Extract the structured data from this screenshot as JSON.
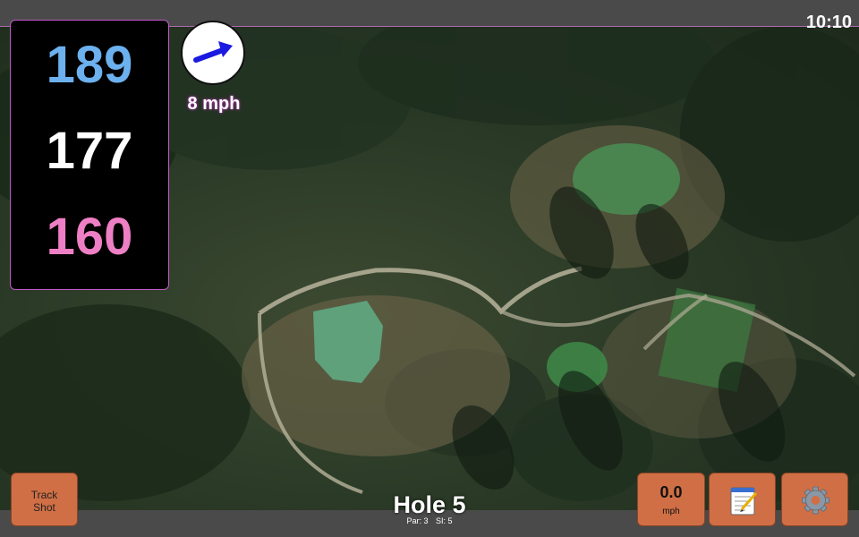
{
  "status_bar": {
    "time": "10:10"
  },
  "distances": {
    "back": "189",
    "middle": "177",
    "front": "160"
  },
  "wind": {
    "speed_label": "8 mph",
    "direction_icon": "arrow-icon",
    "arrow_color": "#1a1ae0"
  },
  "hole": {
    "title": "Hole 5",
    "par_label": "Par: 3",
    "si_label": "SI: 5"
  },
  "buttons": {
    "track_shot_label_line1": "Track",
    "track_shot_label_line2": "Shot",
    "speed_value": "0.0",
    "speed_unit": "mph",
    "notes_icon": "notepad-icon",
    "settings_icon": "gear-icon"
  },
  "colors": {
    "back_distance": "#6cb0ee",
    "middle_distance": "#ffffff",
    "front_distance": "#ee7fc4",
    "button_bg": "#d06f45",
    "panel_border": "#c05ac8"
  }
}
